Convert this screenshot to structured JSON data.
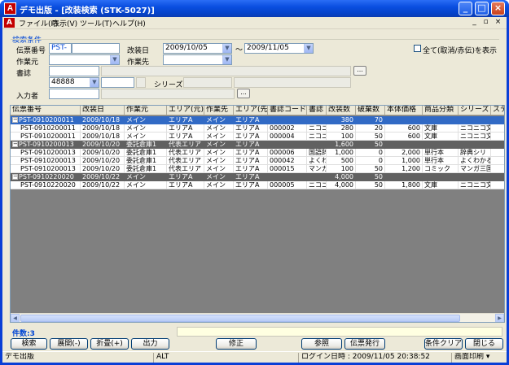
{
  "window": {
    "app_icon": "A",
    "title": "デモ出版 - [改装検索 (STK-5027)]"
  },
  "menu": {
    "items": [
      "ファイル(F)",
      "表示(V)",
      "ツール(T)",
      "ヘルプ(H)"
    ]
  },
  "search": {
    "group_title": "検索条件",
    "slip_no_label": "伝票番号",
    "slip_no_prefix": "PST-",
    "slip_no_value": "",
    "repack_date_label": "改装日",
    "date_from": "2009/10/05",
    "date_sep": "〜",
    "date_to": "2009/11/05",
    "show_all_label": "全て(取消/赤伝)を表示",
    "source_label": "作業元",
    "dest_label": "作業先",
    "book_label": "書誌",
    "code_value": "48888",
    "series_label": "シリーズ",
    "entry_label": "入力者",
    "browse_label": "..."
  },
  "grid": {
    "columns": [
      "伝票番号",
      "改装日",
      "作業元",
      "エリア(元)",
      "作業先",
      "エリア(先)",
      "書誌コード",
      "書誌",
      "改装数",
      "破棄数",
      "本体価格",
      "商品分類",
      "シリーズ",
      "ステ"
    ],
    "rows": [
      {
        "kind": "selected",
        "expander": "−",
        "cells": [
          "PST-0910200011",
          "2009/10/18",
          "メイン",
          "エリアA",
          "メイン",
          "エリアA",
          "",
          "",
          "380",
          "70",
          "",
          "",
          "",
          ""
        ]
      },
      {
        "kind": "normal",
        "cells": [
          "PST-0910200011",
          "2009/10/18",
          "メイン",
          "エリアA",
          "メイン",
          "エリアA",
          "000002",
          "ニコニコ",
          "280",
          "20",
          "600",
          "文庫",
          "ニコニコ文",
          ""
        ]
      },
      {
        "kind": "normal",
        "cells": [
          "PST-0910200011",
          "2009/10/18",
          "メイン",
          "エリアA",
          "メイン",
          "エリアA",
          "000004",
          "ニコニコ",
          "100",
          "50",
          "600",
          "文庫",
          "ニコニコ文",
          ""
        ]
      },
      {
        "kind": "group",
        "expander": "−",
        "cells": [
          "PST-0910200013",
          "2009/10/20",
          "委託倉庫1",
          "代表エリア",
          "メイン",
          "エリアA",
          "",
          "",
          "1,600",
          "50",
          "",
          "",
          "",
          ""
        ]
      },
      {
        "kind": "normal",
        "cells": [
          "PST-0910200013",
          "2009/10/20",
          "委託倉庫1",
          "代表エリア",
          "メイン",
          "エリアA",
          "000006",
          "国語辞",
          "1,000",
          "0",
          "2,000",
          "単行本",
          "辞典シリ",
          ""
        ]
      },
      {
        "kind": "normal",
        "cells": [
          "PST-0910200013",
          "2009/10/20",
          "委託倉庫1",
          "代表エリア",
          "メイン",
          "エリアA",
          "000042",
          "よくわか",
          "500",
          "0",
          "1,000",
          "単行本",
          "よくわかる",
          ""
        ]
      },
      {
        "kind": "normal",
        "cells": [
          "PST-0910200013",
          "2009/10/20",
          "委託倉庫1",
          "代表エリア",
          "メイン",
          "エリアA",
          "000015",
          "マンガ",
          "100",
          "50",
          "1,200",
          "コミック",
          "マンガ三国",
          ""
        ]
      },
      {
        "kind": "group",
        "expander": "−",
        "cells": [
          "PST-0910220020",
          "2009/10/22",
          "メイン",
          "エリアA",
          "メイン",
          "エリアA",
          "",
          "",
          "4,000",
          "50",
          "",
          "",
          "",
          ""
        ]
      },
      {
        "kind": "normal",
        "cells": [
          "PST-0910220020",
          "2009/10/22",
          "メイン",
          "エリアA",
          "メイン",
          "エリアA",
          "000005",
          "ニコニコ",
          "4,000",
          "50",
          "1,800",
          "文庫",
          "ニコニコ文",
          ""
        ]
      }
    ]
  },
  "footer": {
    "count_label": "件数:3",
    "buttons_left": [
      "検索",
      "展開(-)",
      "折畳(+)",
      "出力"
    ],
    "btn_modify": "修正",
    "btn_view": "参照",
    "btn_issue": "伝票発行",
    "btn_clear": "条件クリア",
    "btn_close": "閉じる"
  },
  "status": {
    "company": "デモ出版",
    "mode": "ALT",
    "login": "ログイン日時 : 2009/11/05 20:38:52",
    "print": "画面印刷"
  },
  "colors": {
    "selected_row": "#316ac5",
    "group_row": "#616161",
    "accent_label": "#0046d5",
    "title_bar": "#0a4ee0"
  }
}
